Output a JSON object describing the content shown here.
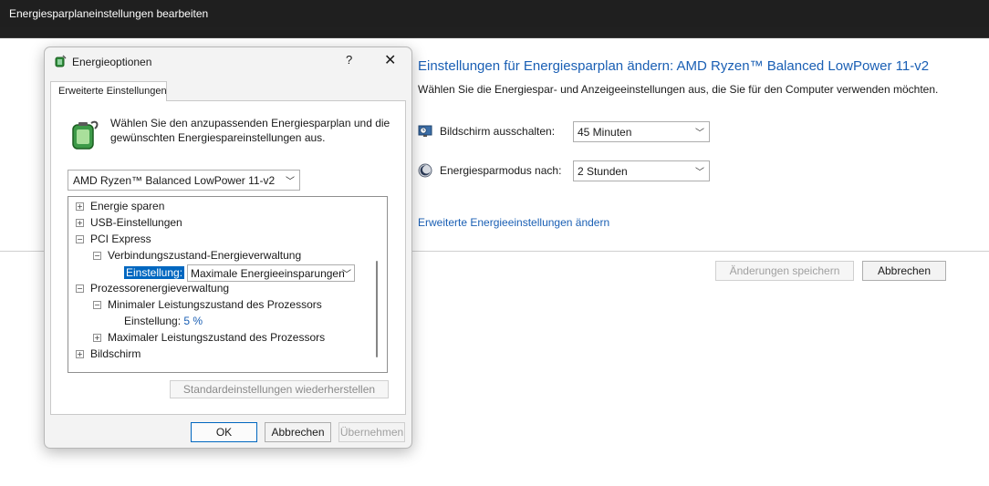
{
  "window": {
    "title": "Energiesparplaneinstellungen bearbeiten"
  },
  "main": {
    "heading": "Einstellungen für Energiesparplan ändern: AMD Ryzen™ Balanced LowPower 11-v2",
    "description": "Wählen Sie die Energiespar- und Anzeigeeinstellungen aus, die Sie für den Computer verwenden möchten.",
    "display_off": {
      "icon": "monitor-clock-icon",
      "label": "Bildschirm ausschalten:",
      "value": "45 Minuten"
    },
    "sleep": {
      "icon": "moon-icon",
      "label": "Energiesparmodus nach:",
      "value": "2 Stunden"
    },
    "advanced_link": "Erweiterte Energieeinstellungen ändern",
    "save_button": "Änderungen speichern",
    "cancel_button": "Abbrechen"
  },
  "dialog": {
    "title": "Energieoptionen",
    "icon": "power-options-icon",
    "help": "?",
    "close": "✕",
    "tab": "Erweiterte Einstellungen",
    "intro": "Wählen Sie den anzupassenden Energiesparplan und die gewünschten Energiespareinstellungen aus.",
    "plan": "AMD Ryzen™ Balanced LowPower 11-v2",
    "tree": {
      "energy_saving": "Energie sparen",
      "usb": "USB-Einstellungen",
      "pci": "PCI Express",
      "link_state": "Verbindungszustand-Energieverwaltung",
      "setting_label": "Einstellung:",
      "link_state_value": "Maximale Energieeinsparungen",
      "processor": "Prozessorenergieverwaltung",
      "min_state": "Minimaler Leistungszustand des Prozessors",
      "min_value": "5 %",
      "max_state": "Maximaler Leistungszustand des Prozessors",
      "display": "Bildschirm"
    },
    "restore_button": "Standardeinstellungen wiederherstellen",
    "ok_button": "OK",
    "cancel_button": "Abbrechen",
    "apply_button": "Übernehmen"
  },
  "colors": {
    "accent": "#0067c0",
    "link": "#1a5fb4",
    "titlebar": "#1f1f1f"
  }
}
